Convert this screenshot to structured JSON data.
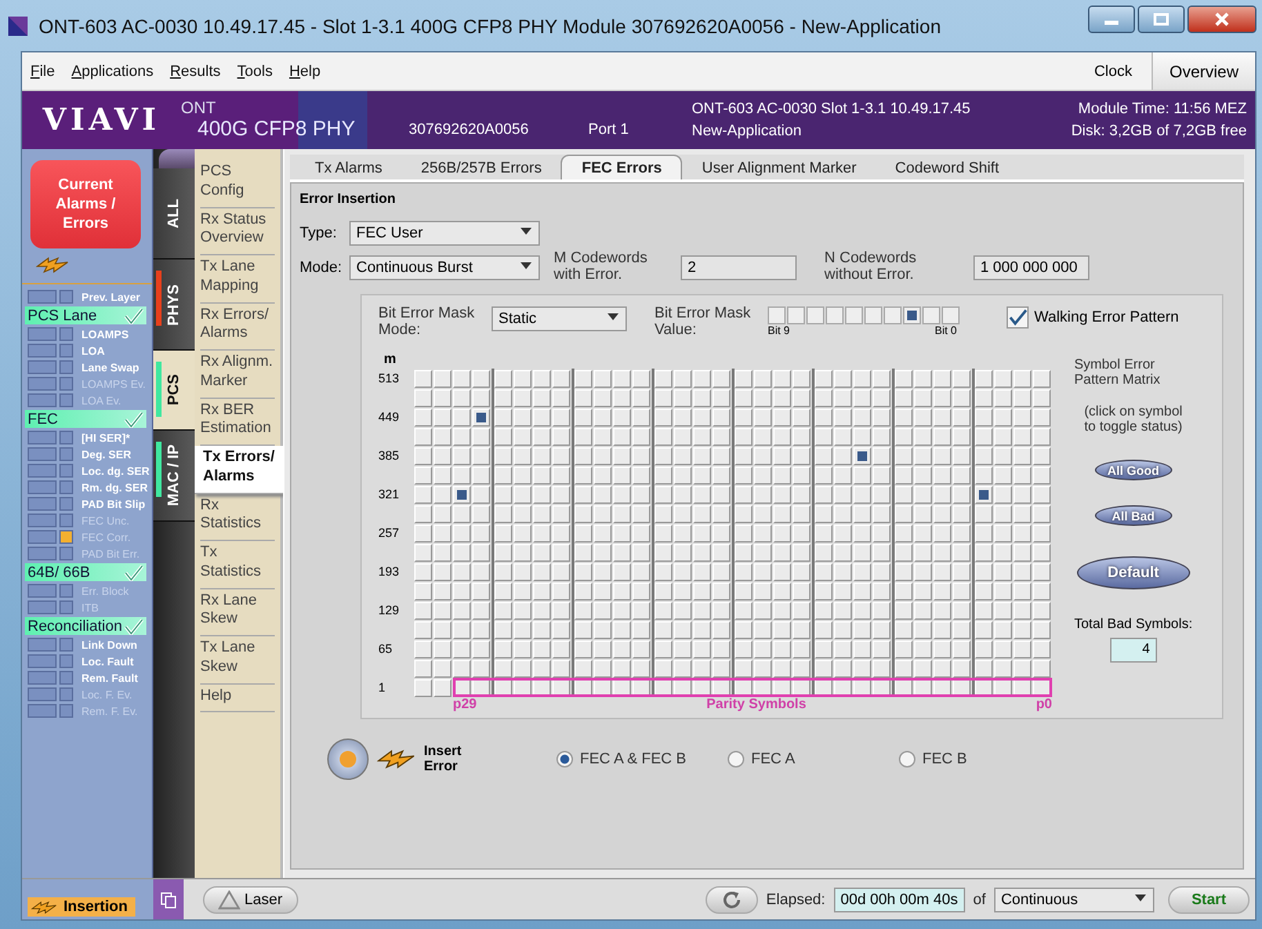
{
  "window": {
    "title": "ONT-603  AC-0030 10.49.17.45 - Slot 1-3.1 400G CFP8 PHY Module 307692620A0056 - New-Application"
  },
  "menu": [
    "File",
    "Applications",
    "Results",
    "Tools",
    "Help"
  ],
  "menu_right": {
    "clock": "Clock",
    "overview": "Overview"
  },
  "header": {
    "logo": "VIAVI",
    "product": "ONT",
    "module": "400G CFP8 PHY",
    "serial": "307692620A0056",
    "port": "Port 1",
    "device": "ONT-603 AC-0030 Slot 1-3.1  10.49.17.45",
    "application": "New-Application",
    "module_time": "Module Time: 11:56 MEZ",
    "disk": "Disk: 3,2GB of 7,2GB free"
  },
  "alarm_panel": {
    "button": "Current\nAlarms /\nErrors",
    "top_items": [
      {
        "label": "Prev. Layer",
        "disabled": false,
        "current": false,
        "history": false
      }
    ],
    "groups": [
      {
        "title": "PCS Lane",
        "ok": true,
        "items": [
          {
            "label": "LOAMPS",
            "disabled": false,
            "current": false,
            "history": false
          },
          {
            "label": "LOA",
            "disabled": false,
            "current": false,
            "history": false
          },
          {
            "label": "Lane Swap",
            "disabled": false,
            "current": false,
            "history": false
          },
          {
            "label": "LOAMPS Ev.",
            "disabled": true,
            "current": false,
            "history": false
          },
          {
            "label": "LOA Ev.",
            "disabled": true,
            "current": false,
            "history": false
          }
        ]
      },
      {
        "title": "FEC",
        "ok": true,
        "items": [
          {
            "label": "[HI SER]*",
            "disabled": false,
            "current": false,
            "history": false
          },
          {
            "label": "Deg. SER",
            "disabled": false,
            "current": false,
            "history": false
          },
          {
            "label": "Loc. dg. SER",
            "disabled": false,
            "current": false,
            "history": false
          },
          {
            "label": "Rm. dg. SER",
            "disabled": false,
            "current": false,
            "history": false
          },
          {
            "label": "PAD Bit Slip",
            "disabled": false,
            "current": false,
            "history": false
          },
          {
            "label": "FEC Unc.",
            "disabled": true,
            "current": false,
            "history": false
          },
          {
            "label": "FEC Corr.",
            "disabled": true,
            "current": false,
            "history": true
          },
          {
            "label": "PAD Bit Err.",
            "disabled": true,
            "current": false,
            "history": false
          }
        ]
      },
      {
        "title": "64B/ 66B",
        "ok": true,
        "items": [
          {
            "label": "Err. Block",
            "disabled": true,
            "current": false,
            "history": false
          },
          {
            "label": "ITB",
            "disabled": true,
            "current": false,
            "history": false
          }
        ]
      },
      {
        "title": "Reconciliation",
        "ok": true,
        "items": [
          {
            "label": "Link Down",
            "disabled": false,
            "current": false,
            "history": false
          },
          {
            "label": "Loc. Fault",
            "disabled": false,
            "current": false,
            "history": false
          },
          {
            "label": "Rem. Fault",
            "disabled": false,
            "current": false,
            "history": false
          },
          {
            "label": "Loc. F. Ev.",
            "disabled": true,
            "current": false,
            "history": false
          },
          {
            "label": "Rem. F. Ev.",
            "disabled": true,
            "current": false,
            "history": false
          }
        ]
      }
    ]
  },
  "side_tabs": [
    {
      "label": "ALL",
      "selected": false
    },
    {
      "label": "PHYS",
      "selected": false,
      "color": "#e8401c"
    },
    {
      "label": "PCS",
      "selected": true,
      "color": "#40e8a0"
    },
    {
      "label": "MAC / IP",
      "selected": false,
      "color": "#40e8a0"
    }
  ],
  "nav": [
    {
      "label": "PCS\nConfig",
      "selected": false
    },
    {
      "label": "Rx Status\nOverview",
      "selected": false
    },
    {
      "label": "Tx Lane\nMapping",
      "selected": false
    },
    {
      "label": "Rx Errors/\nAlarms",
      "selected": false
    },
    {
      "label": "Rx Alignm.\nMarker",
      "selected": false
    },
    {
      "label": "Rx BER\nEstimation",
      "selected": false
    },
    {
      "label": "Tx Errors/\nAlarms",
      "selected": true
    },
    {
      "label": "Rx\nStatistics",
      "selected": false
    },
    {
      "label": "Tx\nStatistics",
      "selected": false
    },
    {
      "label": "Rx Lane\nSkew",
      "selected": false
    },
    {
      "label": "Tx Lane\nSkew",
      "selected": false
    },
    {
      "label": "Help",
      "selected": false
    }
  ],
  "content_tabs": [
    {
      "label": "Tx Alarms",
      "selected": false
    },
    {
      "label": "256B/257B Errors",
      "selected": false
    },
    {
      "label": "FEC Errors",
      "selected": true
    },
    {
      "label": "User Alignment Marker",
      "selected": false
    },
    {
      "label": "Codeword Shift",
      "selected": false
    }
  ],
  "error_insertion": {
    "title": "Error Insertion",
    "type_label": "Type:",
    "type": "FEC User",
    "mode_label": "Mode:",
    "mode": "Continuous Burst",
    "m_label": "M Codewords\nwith Error.",
    "m_value": "2",
    "n_label": "N Codewords\nwithout Error.",
    "n_value": "1 000 000 000",
    "mask_mode_label": "Bit Error Mask\nMode:",
    "mask_mode": "Static",
    "mask_value_label": "Bit Error Mask\nValue:",
    "mask_bits": [
      false,
      false,
      false,
      false,
      false,
      false,
      false,
      true,
      false,
      false
    ],
    "bit_high": "Bit 9",
    "bit_low": "Bit 0",
    "walking": {
      "label": "Walking Error Pattern",
      "checked": true
    }
  },
  "matrix": {
    "axis": "m",
    "rows": [
      {
        "label": "513",
        "bad": [
          false,
          false,
          false,
          false,
          false,
          false,
          false,
          false,
          false,
          false,
          false,
          false,
          false,
          false,
          false,
          false,
          false,
          false,
          false,
          false,
          false,
          false,
          false,
          false,
          false,
          false,
          false,
          false,
          false,
          false,
          false,
          false
        ]
      },
      {
        "bad": [
          false,
          false,
          false,
          false,
          false,
          false,
          false,
          false,
          false,
          false,
          false,
          false,
          false,
          false,
          false,
          false,
          false,
          false,
          false,
          false,
          false,
          false,
          false,
          false,
          false,
          false,
          false,
          false,
          false,
          false,
          false,
          false
        ]
      },
      {
        "label": "449",
        "bad": [
          false,
          false,
          false,
          true,
          false,
          false,
          false,
          false,
          false,
          false,
          false,
          false,
          false,
          false,
          false,
          false,
          false,
          false,
          false,
          false,
          false,
          false,
          false,
          false,
          false,
          false,
          false,
          false,
          false,
          false,
          false,
          false
        ]
      },
      {
        "bad": [
          false,
          false,
          false,
          false,
          false,
          false,
          false,
          false,
          false,
          false,
          false,
          false,
          false,
          false,
          false,
          false,
          false,
          false,
          false,
          false,
          false,
          false,
          false,
          false,
          false,
          false,
          false,
          false,
          false,
          false,
          false,
          false
        ]
      },
      {
        "label": "385",
        "bad": [
          false,
          false,
          false,
          false,
          false,
          false,
          false,
          false,
          false,
          false,
          false,
          false,
          false,
          false,
          false,
          false,
          false,
          false,
          false,
          false,
          false,
          false,
          true,
          false,
          false,
          false,
          false,
          false,
          false,
          false,
          false,
          false
        ]
      },
      {
        "bad": [
          false,
          false,
          false,
          false,
          false,
          false,
          false,
          false,
          false,
          false,
          false,
          false,
          false,
          false,
          false,
          false,
          false,
          false,
          false,
          false,
          false,
          false,
          false,
          false,
          false,
          false,
          false,
          false,
          false,
          false,
          false,
          false
        ]
      },
      {
        "label": "321",
        "bad": [
          false,
          false,
          true,
          false,
          false,
          false,
          false,
          false,
          false,
          false,
          false,
          false,
          false,
          false,
          false,
          false,
          false,
          false,
          false,
          false,
          false,
          false,
          false,
          false,
          false,
          false,
          false,
          false,
          true,
          false,
          false,
          false
        ]
      },
      {
        "bad": [
          false,
          false,
          false,
          false,
          false,
          false,
          false,
          false,
          false,
          false,
          false,
          false,
          false,
          false,
          false,
          false,
          false,
          false,
          false,
          false,
          false,
          false,
          false,
          false,
          false,
          false,
          false,
          false,
          false,
          false,
          false,
          false
        ]
      },
      {
        "label": "257",
        "bad": [
          false,
          false,
          false,
          false,
          false,
          false,
          false,
          false,
          false,
          false,
          false,
          false,
          false,
          false,
          false,
          false,
          false,
          false,
          false,
          false,
          false,
          false,
          false,
          false,
          false,
          false,
          false,
          false,
          false,
          false,
          false,
          false
        ]
      },
      {
        "bad": [
          false,
          false,
          false,
          false,
          false,
          false,
          false,
          false,
          false,
          false,
          false,
          false,
          false,
          false,
          false,
          false,
          false,
          false,
          false,
          false,
          false,
          false,
          false,
          false,
          false,
          false,
          false,
          false,
          false,
          false,
          false,
          false
        ]
      },
      {
        "label": "193",
        "bad": [
          false,
          false,
          false,
          false,
          false,
          false,
          false,
          false,
          false,
          false,
          false,
          false,
          false,
          false,
          false,
          false,
          false,
          false,
          false,
          false,
          false,
          false,
          false,
          false,
          false,
          false,
          false,
          false,
          false,
          false,
          false,
          false
        ]
      },
      {
        "bad": [
          false,
          false,
          false,
          false,
          false,
          false,
          false,
          false,
          false,
          false,
          false,
          false,
          false,
          false,
          false,
          false,
          false,
          false,
          false,
          false,
          false,
          false,
          false,
          false,
          false,
          false,
          false,
          false,
          false,
          false,
          false,
          false
        ]
      },
      {
        "label": "129",
        "bad": [
          false,
          false,
          false,
          false,
          false,
          false,
          false,
          false,
          false,
          false,
          false,
          false,
          false,
          false,
          false,
          false,
          false,
          false,
          false,
          false,
          false,
          false,
          false,
          false,
          false,
          false,
          false,
          false,
          false,
          false,
          false,
          false
        ]
      },
      {
        "bad": [
          false,
          false,
          false,
          false,
          false,
          false,
          false,
          false,
          false,
          false,
          false,
          false,
          false,
          false,
          false,
          false,
          false,
          false,
          false,
          false,
          false,
          false,
          false,
          false,
          false,
          false,
          false,
          false,
          false,
          false,
          false,
          false
        ]
      },
      {
        "label": "65",
        "bad": [
          false,
          false,
          false,
          false,
          false,
          false,
          false,
          false,
          false,
          false,
          false,
          false,
          false,
          false,
          false,
          false,
          false,
          false,
          false,
          false,
          false,
          false,
          false,
          false,
          false,
          false,
          false,
          false,
          false,
          false,
          false,
          false
        ]
      },
      {
        "bad": [
          false,
          false,
          false,
          false,
          false,
          false,
          false,
          false,
          false,
          false,
          false,
          false,
          false,
          false,
          false,
          false,
          false,
          false,
          false,
          false,
          false,
          false,
          false,
          false,
          false,
          false,
          false,
          false,
          false,
          false,
          false,
          false
        ]
      },
      {
        "label": "1",
        "bad": [
          false,
          false,
          false,
          false,
          false,
          false,
          false,
          false,
          false,
          false,
          false,
          false,
          false,
          false,
          false,
          false,
          false,
          false,
          false,
          false,
          false,
          false,
          false,
          false,
          false,
          false,
          false,
          false,
          false,
          false,
          false,
          false
        ]
      }
    ],
    "parity_start": "p29",
    "parity_title": "Parity Symbols",
    "parity_end": "p0",
    "title": "Symbol Error\nPattern Matrix",
    "hint": "(click on symbol\nto toggle status)",
    "buttons": [
      "All Good",
      "All Bad",
      "Default"
    ],
    "total_label": "Total Bad Symbols:",
    "total": "4"
  },
  "insert": {
    "label": "Insert\nError",
    "options": [
      {
        "label": "FEC A & FEC B",
        "selected": true
      },
      {
        "label": "FEC A",
        "selected": false
      },
      {
        "label": "FEC B",
        "selected": false
      }
    ]
  },
  "status_bar": {
    "mode": "Insertion",
    "laser": "Laser",
    "elapsed_label": "Elapsed:",
    "elapsed": "00d 00h 00m 40s",
    "of": "of",
    "duration": "Continuous",
    "start": "Start"
  }
}
